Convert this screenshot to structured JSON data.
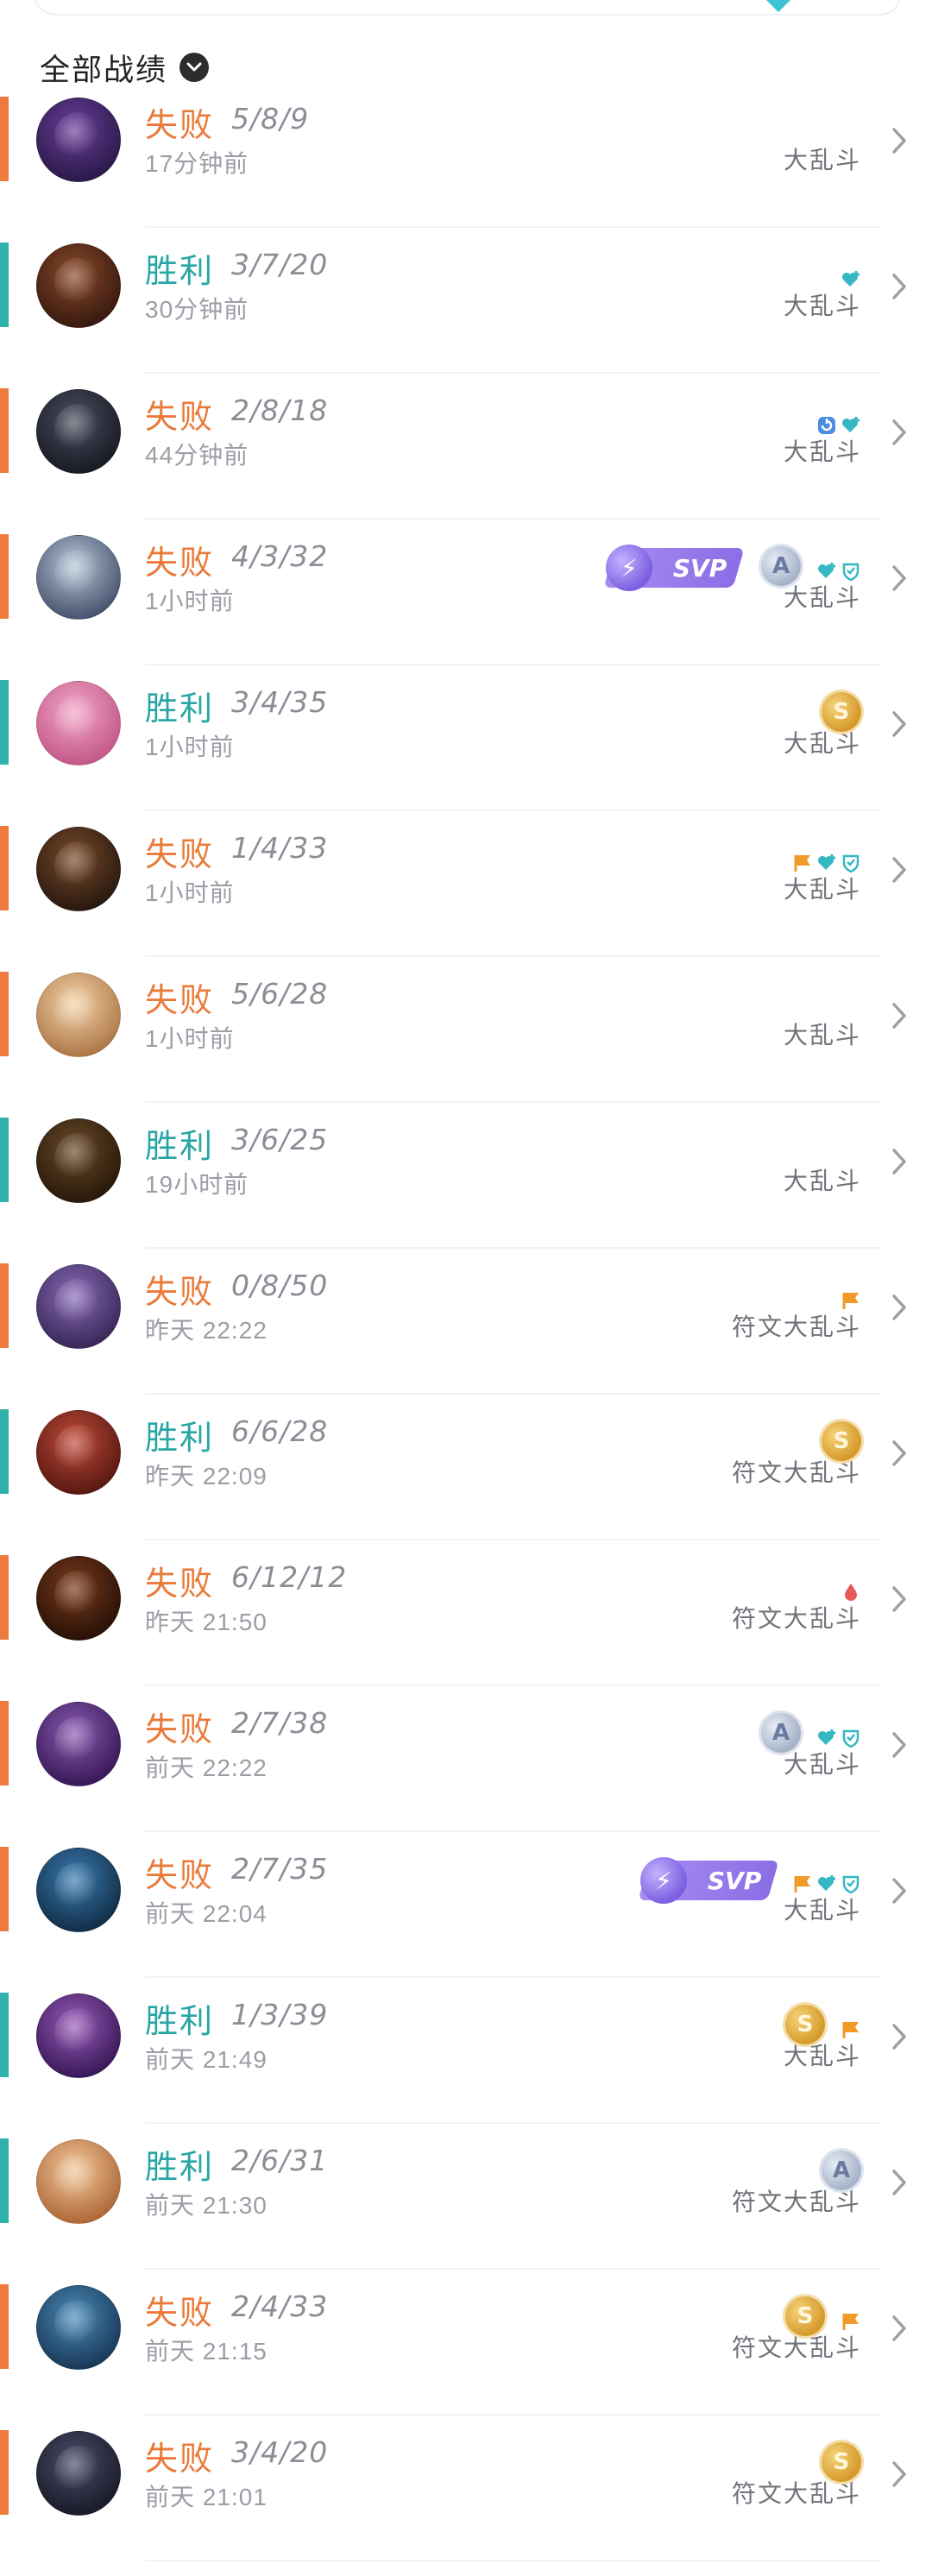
{
  "header": {
    "filter_label": "全部战绩"
  },
  "colors": {
    "lose": "#ee7a3d",
    "win": "#2fb1ac"
  },
  "matches": [
    {
      "result": "失败",
      "kda": "5/8/9",
      "time": "17分钟前",
      "mode": "大乱斗",
      "outcome": "lose",
      "avatar": [
        "#6b3d9a",
        "#2b1b4a"
      ],
      "medal": null,
      "svp": false,
      "icons": []
    },
    {
      "result": "胜利",
      "kda": "3/7/20",
      "time": "30分钟前",
      "mode": "大乱斗",
      "outcome": "win",
      "avatar": [
        "#8a4a2a",
        "#3a1a10"
      ],
      "medal": null,
      "svp": false,
      "icons": [
        "heart-plus-icon"
      ]
    },
    {
      "result": "失败",
      "kda": "2/8/18",
      "time": "44分钟前",
      "mode": "大乱斗",
      "outcome": "lose",
      "avatar": [
        "#4a4e5e",
        "#1a1c26"
      ],
      "medal": null,
      "svp": false,
      "icons": [
        "hook-icon",
        "heart-plus-icon"
      ]
    },
    {
      "result": "失败",
      "kda": "4/3/32",
      "time": "1小时前",
      "mode": "大乱斗",
      "outcome": "lose",
      "avatar": [
        "#b6c6d8",
        "#4a5670"
      ],
      "medal": "A",
      "svp": true,
      "icons": [
        "heart-plus-icon",
        "shield-icon"
      ]
    },
    {
      "result": "胜利",
      "kda": "3/4/35",
      "time": "1小时前",
      "mode": "大乱斗",
      "outcome": "win",
      "avatar": [
        "#f2a6c8",
        "#c45a8a"
      ],
      "medal": "S",
      "svp": false,
      "icons": []
    },
    {
      "result": "失败",
      "kda": "1/4/33",
      "time": "1小时前",
      "mode": "大乱斗",
      "outcome": "lose",
      "avatar": [
        "#7a4a2a",
        "#2a1a10"
      ],
      "medal": null,
      "svp": false,
      "icons": [
        "flag-icon",
        "heart-plus-icon",
        "shield-icon"
      ]
    },
    {
      "result": "失败",
      "kda": "5/6/28",
      "time": "1小时前",
      "mode": "大乱斗",
      "outcome": "lose",
      "avatar": [
        "#f2d3a8",
        "#b07a4a"
      ],
      "medal": null,
      "svp": false,
      "icons": []
    },
    {
      "result": "胜利",
      "kda": "3/6/25",
      "time": "19小时前",
      "mode": "大乱斗",
      "outcome": "win",
      "avatar": [
        "#6a4a2a",
        "#2a1a0a"
      ],
      "medal": null,
      "svp": false,
      "icons": []
    },
    {
      "result": "失败",
      "kda": "0/8/50",
      "time": "昨天 22:22",
      "mode": "符文大乱斗",
      "outcome": "lose",
      "avatar": [
        "#8a6ab8",
        "#3a2a5a"
      ],
      "medal": null,
      "svp": false,
      "icons": [
        "flag-icon"
      ]
    },
    {
      "result": "胜利",
      "kda": "6/6/28",
      "time": "昨天 22:09",
      "mode": "符文大乱斗",
      "outcome": "win",
      "avatar": [
        "#c04a3a",
        "#5a1a12"
      ],
      "medal": "S",
      "svp": false,
      "icons": []
    },
    {
      "result": "失败",
      "kda": "6/12/12",
      "time": "昨天 21:50",
      "mode": "符文大乱斗",
      "outcome": "lose",
      "avatar": [
        "#7a3a1a",
        "#2a1208"
      ],
      "medal": null,
      "svp": false,
      "icons": [
        "drop-icon"
      ]
    },
    {
      "result": "失败",
      "kda": "2/7/38",
      "time": "前天 22:22",
      "mode": "大乱斗",
      "outcome": "lose",
      "avatar": [
        "#8a5ab0",
        "#3a1a5a"
      ],
      "medal": "A",
      "svp": false,
      "icons": [
        "heart-plus-icon",
        "shield-icon"
      ]
    },
    {
      "result": "失败",
      "kda": "2/7/35",
      "time": "前天 22:04",
      "mode": "大乱斗",
      "outcome": "lose",
      "avatar": [
        "#3a7ab0",
        "#12304a"
      ],
      "medal": null,
      "svp": true,
      "icons": [
        "flag-icon",
        "heart-plus-icon",
        "shield-icon"
      ]
    },
    {
      "result": "胜利",
      "kda": "1/3/39",
      "time": "前天 21:49",
      "mode": "大乱斗",
      "outcome": "win",
      "avatar": [
        "#9a5ab8",
        "#3a1a5a"
      ],
      "medal": "S",
      "svp": false,
      "icons": [
        "flag-icon"
      ]
    },
    {
      "result": "胜利",
      "kda": "2/6/31",
      "time": "前天 21:30",
      "mode": "符文大乱斗",
      "outcome": "win",
      "avatar": [
        "#f2c89a",
        "#b06a3a"
      ],
      "medal": "A",
      "svp": false,
      "icons": []
    },
    {
      "result": "失败",
      "kda": "2/4/33",
      "time": "前天 21:15",
      "mode": "符文大乱斗",
      "outcome": "lose",
      "avatar": [
        "#4a8ab8",
        "#1a3a5a"
      ],
      "medal": "S",
      "svp": false,
      "icons": [
        "flag-icon"
      ]
    },
    {
      "result": "失败",
      "kda": "3/4/20",
      "time": "前天 21:01",
      "mode": "符文大乱斗",
      "outcome": "lose",
      "avatar": [
        "#4a4e6a",
        "#1a1c2a"
      ],
      "medal": "S",
      "svp": false,
      "icons": []
    }
  ],
  "svp_label": "SVP"
}
